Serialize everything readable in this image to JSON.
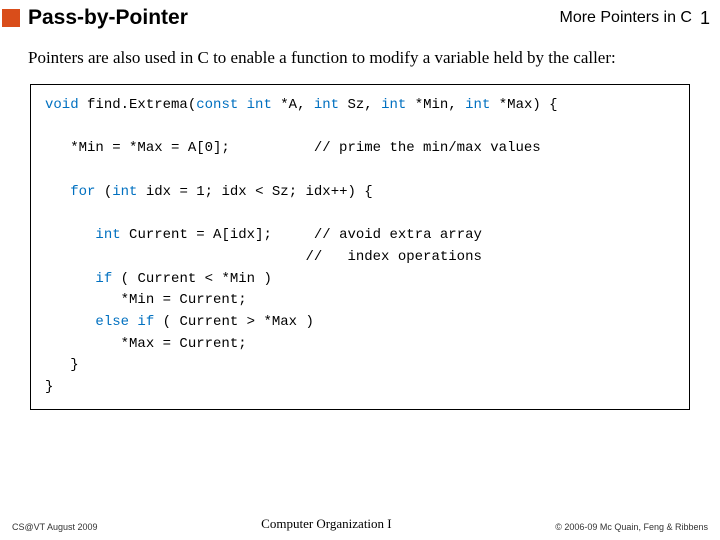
{
  "header": {
    "title": "Pass-by-Pointer",
    "topright": "More Pointers in C",
    "pagenum": "1"
  },
  "intro": "Pointers are also used in C to enable a function to modify a variable held by the caller:",
  "code": {
    "l1a": "void",
    "l1b": " find.Extrema(",
    "l1c": "const int",
    "l1d": " *A, ",
    "l1e": "int",
    "l1f": " Sz, ",
    "l1g": "int",
    "l1h": " *Min, ",
    "l1i": "int",
    "l1j": " *Max) {",
    "l2": "   *Min = *Max = A[0];          // prime the min/max values",
    "l3a": "   ",
    "l3b": "for",
    "l3c": " (",
    "l3d": "int",
    "l3e": " idx = 1; idx < Sz; idx++) {",
    "l4a": "      ",
    "l4b": "int",
    "l4c": " Current = A[idx];     // avoid extra array",
    "l5": "                               //   index operations",
    "l6a": "      ",
    "l6b": "if",
    "l6c": " ( Current < *Min )",
    "l7": "         *Min = Current;",
    "l8a": "      ",
    "l8b": "else if",
    "l8c": " ( Current > *Max )",
    "l9": "         *Max = Current;",
    "l10": "   }",
    "l11": "}"
  },
  "footer": {
    "left": "CS@VT August 2009",
    "center": "Computer Organization I",
    "right": "© 2006-09  Mc Quain, Feng & Ribbens"
  }
}
